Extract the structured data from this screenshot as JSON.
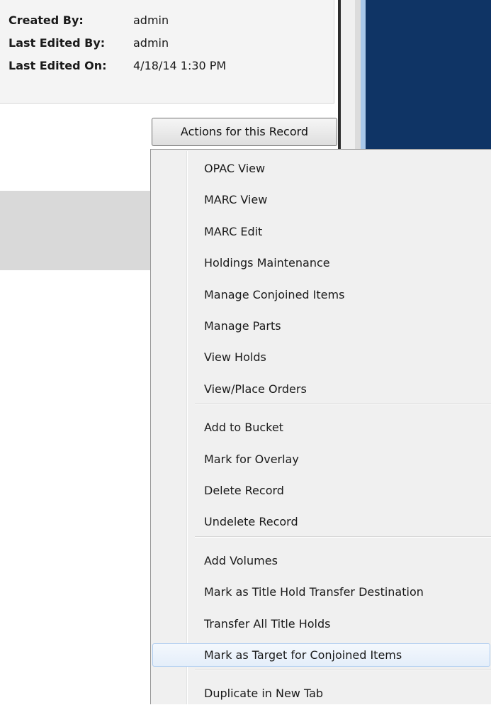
{
  "record_info": {
    "rows": [
      {
        "label": "Created By:",
        "value": "admin"
      },
      {
        "label": "Last Edited By:",
        "value": "admin"
      },
      {
        "label": "Last Edited On:",
        "value": "4/18/14 1:30 PM"
      }
    ]
  },
  "actions_button": {
    "label": "Actions for this Record"
  },
  "menu": {
    "groups": [
      [
        "OPAC View",
        "MARC View",
        "MARC Edit",
        "Holdings Maintenance",
        "Manage Conjoined Items",
        "Manage Parts",
        "View Holds",
        "View/Place Orders"
      ],
      [
        "Add to Bucket",
        "Mark for Overlay",
        "Delete Record",
        "Undelete Record"
      ],
      [
        "Add Volumes",
        "Mark as Title Hold Transfer Destination",
        "Transfer All Title Holds",
        "Mark as Target for Conjoined Items"
      ],
      [
        "Duplicate in New Tab"
      ]
    ],
    "highlighted": "Mark as Target for Conjoined Items"
  },
  "colors": {
    "panel_background": "#f4f4f4",
    "menu_background": "#f0f0f0",
    "blue_panel": "#0f3465",
    "highlight_border": "#aecdf1"
  }
}
